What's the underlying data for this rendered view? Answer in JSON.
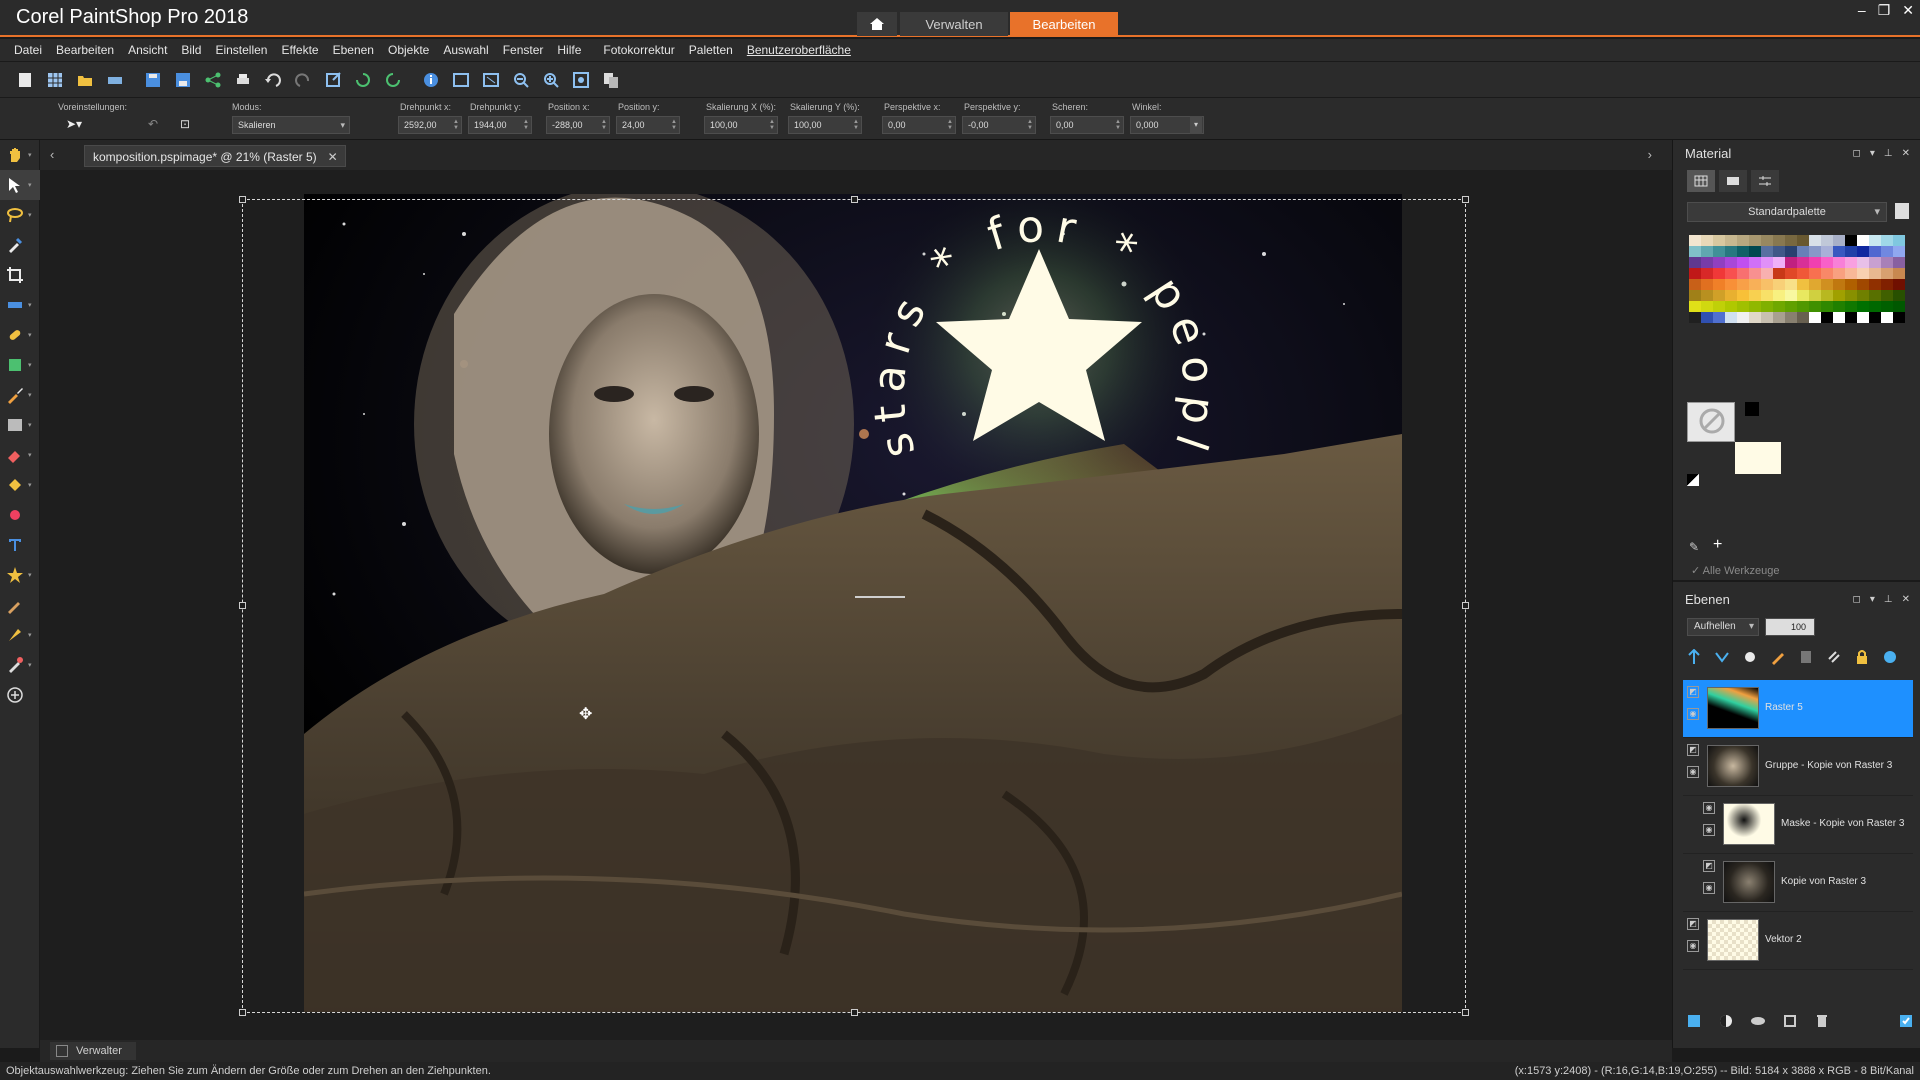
{
  "app": {
    "title": "Corel PaintShop Pro 2018",
    "nav_tabs": [
      "Verwalten",
      "Bearbeiten"
    ],
    "active_tab": "Bearbeiten",
    "accent_color": "#e8722a"
  },
  "menu": {
    "items": [
      "Datei",
      "Bearbeiten",
      "Ansicht",
      "Bild",
      "Einstellen",
      "Effekte",
      "Ebenen",
      "Objekte",
      "Auswahl",
      "Fenster",
      "Hilfe",
      "Fotokorrektur",
      "Paletten",
      "Benutzeroberfläche"
    ]
  },
  "tool_options": {
    "presets_label": "Voreinstellungen:",
    "mode_label": "Modus:",
    "mode_value": "Skalieren",
    "fields": [
      {
        "label": "Drehpunkt x:",
        "value": "2592,00"
      },
      {
        "label": "Drehpunkt y:",
        "value": "1944,00"
      },
      {
        "label": "Position x:",
        "value": "-288,00"
      },
      {
        "label": "Position y:",
        "value": "24,00"
      },
      {
        "label": "Skalierung X (%):",
        "value": "100,00"
      },
      {
        "label": "Skalierung Y (%):",
        "value": "100,00"
      },
      {
        "label": "Perspektive x:",
        "value": "0,00"
      },
      {
        "label": "Perspektive y:",
        "value": "-0,00"
      },
      {
        "label": "Scheren:",
        "value": "0,00"
      },
      {
        "label": "Winkel:",
        "value": "0,000"
      }
    ]
  },
  "document": {
    "tab_label": "komposition.pspimage* @  21% (Raster 5)",
    "artwork_text": "stars * for * people"
  },
  "material_panel": {
    "title": "Material",
    "palette_name": "Standardpalette",
    "all_tools_label": "Alle Werkzeuge"
  },
  "layers_panel": {
    "title": "Ebenen",
    "blend_mode": "Aufhellen",
    "opacity": "100",
    "layers": [
      {
        "name": "Raster 5",
        "selected": true
      },
      {
        "name": "Gruppe - Kopie von Raster 3",
        "selected": false
      },
      {
        "name": "Maske - Kopie von Raster 3",
        "selected": false
      },
      {
        "name": "Kopie von Raster 3",
        "selected": false
      },
      {
        "name": "Vektor 2",
        "selected": false
      }
    ]
  },
  "organizer": {
    "tab_label": "Verwalter"
  },
  "status": {
    "left": "Objektauswahlwerkzeug: Ziehen Sie zum Ändern der Größe oder zum Drehen an den Ziehpunkten.",
    "right": "(x:1573 y:2408) - (R:16,G:14,B:19,O:255) -- Bild:  5184 x 3888 x RGB - 8 Bit/Kanal"
  }
}
